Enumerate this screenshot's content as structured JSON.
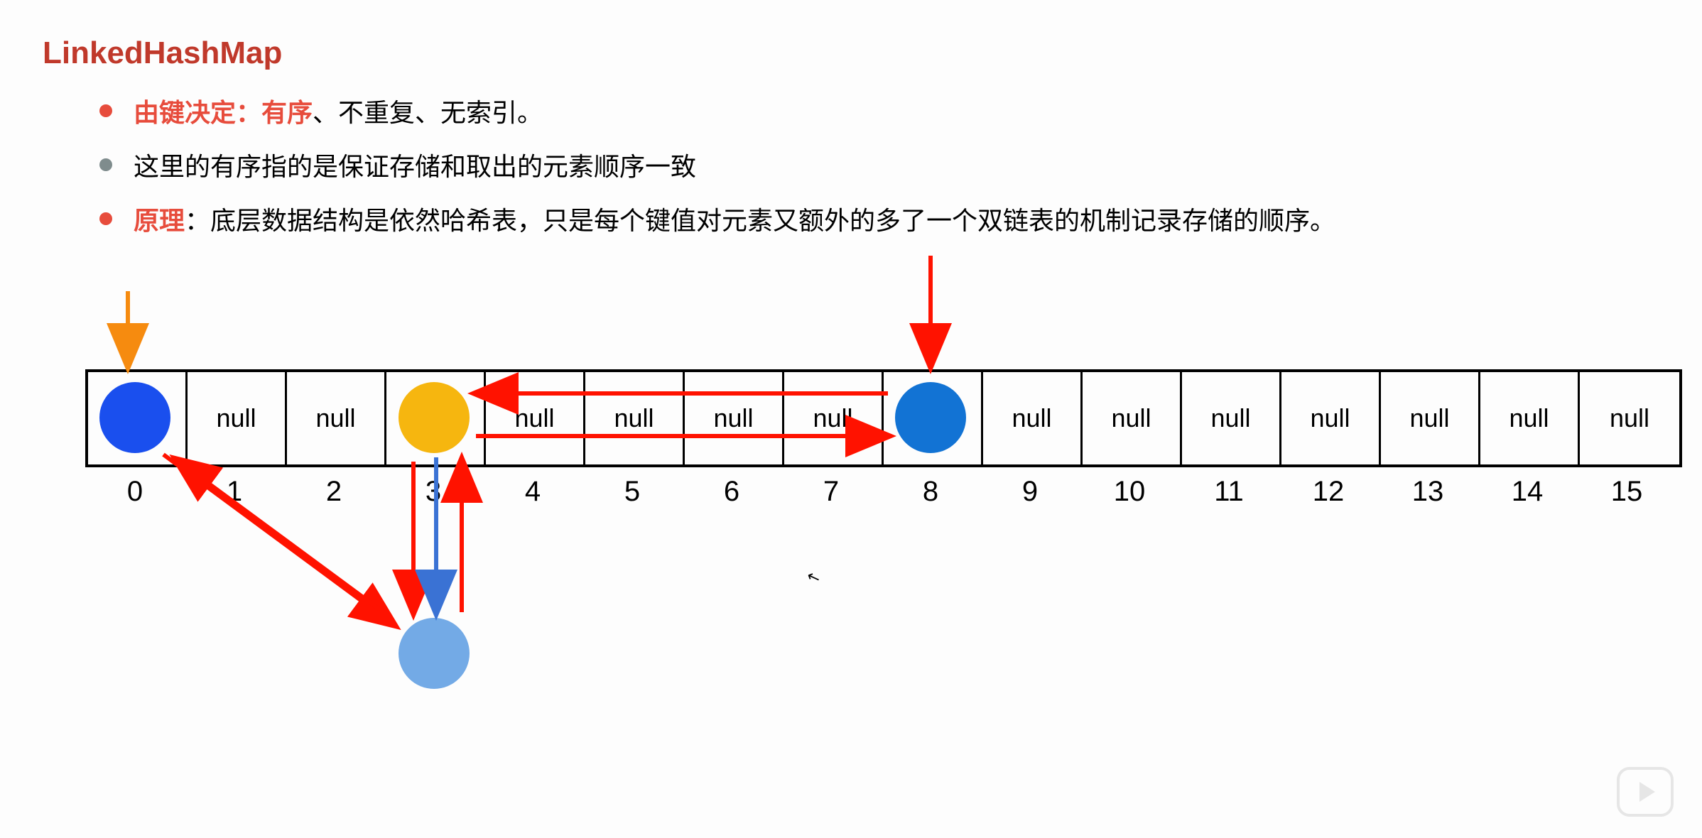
{
  "title": "LinkedHashMap",
  "bullets": [
    {
      "color": "red",
      "red_part": "由键决定：有序",
      "black_part": "、不重复、无索引。"
    },
    {
      "color": "gray",
      "red_part": "",
      "black_part": "这里的有序指的是保证存储和取出的元素顺序一致"
    },
    {
      "color": "red",
      "red_part": "原理",
      "black_part": "：底层数据结构是依然哈希表，只是每个键值对元素又额外的多了一个双链表的机制记录存储的顺序。"
    }
  ],
  "cells": [
    "",
    "null",
    "null",
    "",
    "null",
    "null",
    "null",
    "null",
    "",
    "null",
    "null",
    "null",
    "null",
    "null",
    "null",
    "null"
  ],
  "indices": [
    "0",
    "1",
    "2",
    "3",
    "4",
    "5",
    "6",
    "7",
    "8",
    "9",
    "10",
    "11",
    "12",
    "13",
    "14",
    "15"
  ],
  "nodes": {
    "n0": {
      "index": 0,
      "color": "blue-dark"
    },
    "n3": {
      "index": 3,
      "color": "orange"
    },
    "n8": {
      "index": 8,
      "color": "blue-med"
    },
    "chain3": {
      "index": 3,
      "color": "blue-light",
      "chain": true
    }
  }
}
